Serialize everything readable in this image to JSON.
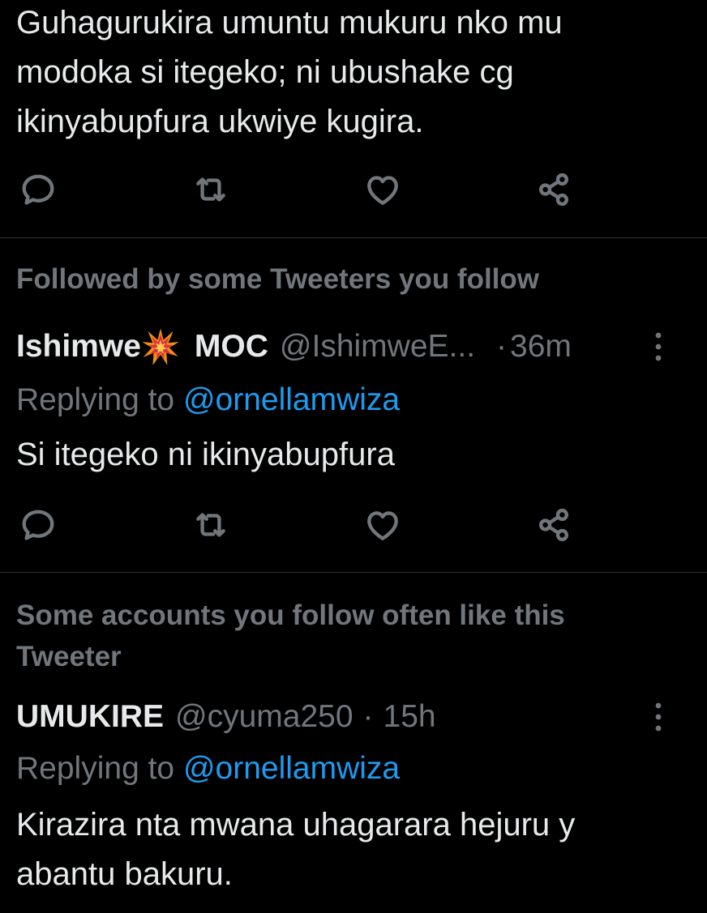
{
  "tweet1": {
    "lines": [
      "Guhagurukira umuntu mukuru nko mu",
      "modoka si itegeko; ni ubushake cg",
      "ikinyabupfura ukwiye kugira."
    ]
  },
  "tweet2": {
    "social_context": "Followed by some Tweeters you follow",
    "display_name_part1": "Ishimwe",
    "display_name_emoji": "collision-emoji",
    "display_name_part2": "MOC",
    "handle": "@IshimweE...",
    "separator": "·",
    "time": "36m",
    "replying_prefix": "Replying to ",
    "replying_mention": "@ornellamwiza",
    "text": "Si itegeko ni ikinyabupfura"
  },
  "tweet3": {
    "social_context_lines": [
      "Some accounts you follow often like this",
      "Tweeter"
    ],
    "display_name": "UMUKIRE",
    "handle": "@cyuma250",
    "separator": "·",
    "time": "15h",
    "replying_prefix": "Replying to ",
    "replying_mention": "@ornellamwiza",
    "lines": [
      "Kirazira nta mwana uhagarara hejuru y",
      "abantu bakuru."
    ]
  },
  "icons": {
    "reply": "reply-icon",
    "retweet": "retweet-icon",
    "like": "heart-icon",
    "share": "share-icon",
    "more": "more-vertical-icon"
  },
  "colors": {
    "background": "#000000",
    "text_primary": "#e7e9ea",
    "text_secondary": "#71767b",
    "link": "#1d9bf0",
    "divider": "#2f3336"
  }
}
